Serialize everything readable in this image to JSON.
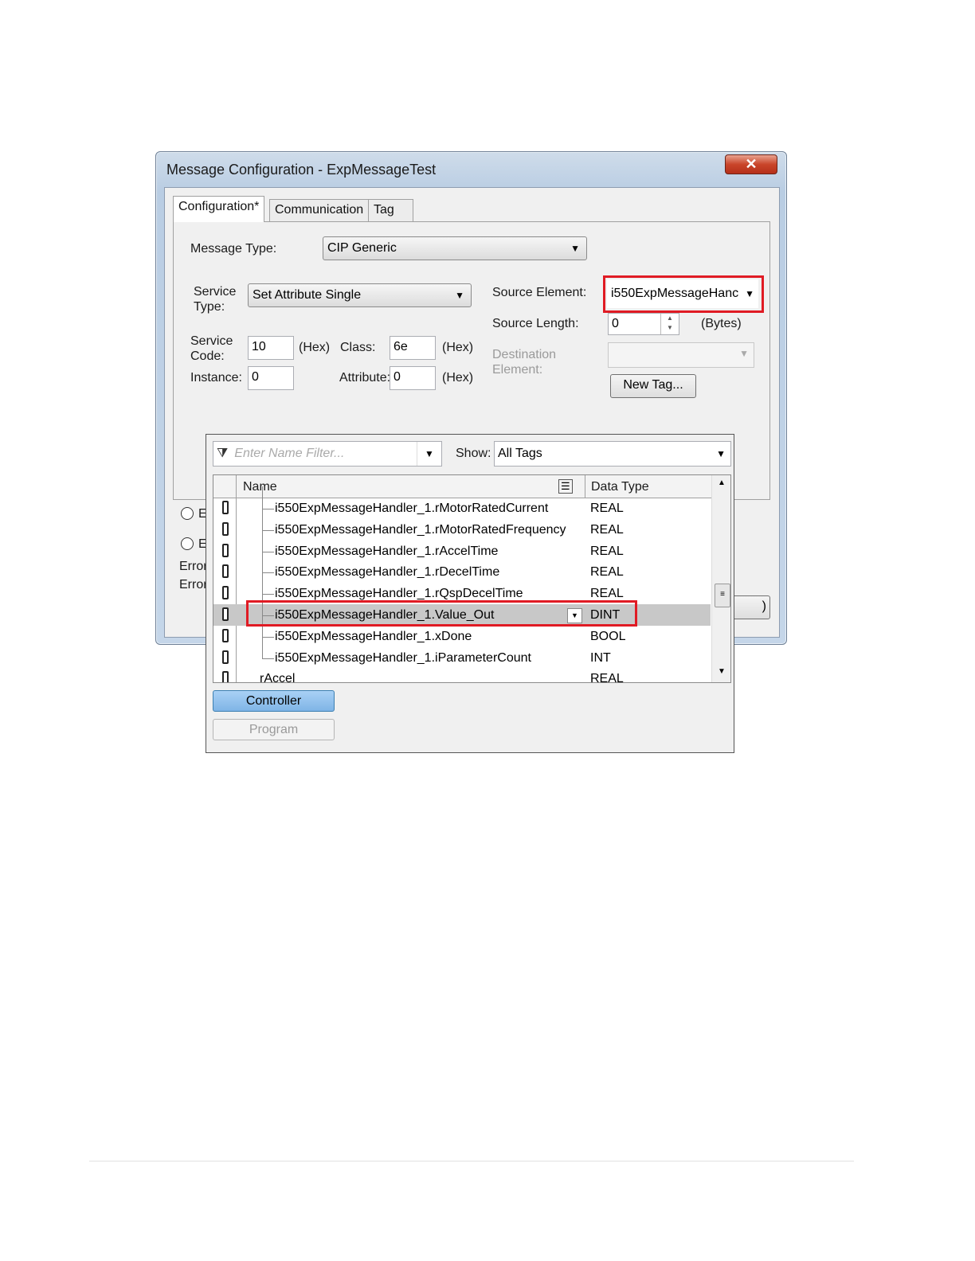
{
  "window": {
    "title": "Message Configuration - ExpMessageTest",
    "close_glyph": "✕"
  },
  "tabs": [
    {
      "label": "Configuration*"
    },
    {
      "label": "Communication"
    },
    {
      "label": "Tag"
    }
  ],
  "config": {
    "message_type_label": "Message Type:",
    "message_type_value": "CIP Generic",
    "service_type_label_1": "Service",
    "service_type_label_2": "Type:",
    "service_type_value": "Set Attribute Single",
    "service_code_label_1": "Service",
    "service_code_label_2": "Code:",
    "service_code_value": "10",
    "hex1": "(Hex)",
    "class_label": "Class:",
    "class_value": "6e",
    "hex2": "(Hex)",
    "instance_label": "Instance:",
    "instance_value": "0",
    "attribute_label": "Attribute:",
    "attribute_value": "0",
    "hex3": "(Hex)",
    "source_element_label": "Source Element:",
    "source_element_value": "i550ExpMessageHanc",
    "source_length_label": "Source Length:",
    "source_length_value": "0",
    "bytes_label": "(Bytes)",
    "destination_label_1": "Destination",
    "destination_label_2": "Element:",
    "new_tag_button": "New Tag..."
  },
  "lower": {
    "radio1_partial": "E",
    "radio2_partial": "E",
    "error1_partial": "Error",
    "error2_partial": "Error",
    "button_partial": ")"
  },
  "tag_browser": {
    "filter_placeholder": "Enter Name Filter...",
    "show_label": "Show:",
    "show_value": "All Tags",
    "col_name": "Name",
    "col_type": "Data Type",
    "rows": [
      {
        "name": "i550ExpMessageHandler_1.rMotorRatedCurrent",
        "type": "REAL"
      },
      {
        "name": "i550ExpMessageHandler_1.rMotorRatedFrequency",
        "type": "REAL"
      },
      {
        "name": "i550ExpMessageHandler_1.rAccelTime",
        "type": "REAL"
      },
      {
        "name": "i550ExpMessageHandler_1.rDecelTime",
        "type": "REAL"
      },
      {
        "name": "i550ExpMessageHandler_1.rQspDecelTime",
        "type": "REAL"
      },
      {
        "name": "i550ExpMessageHandler_1.Value_Out",
        "type": "DINT"
      },
      {
        "name": "i550ExpMessageHandler_1.xDone",
        "type": "BOOL"
      },
      {
        "name": "i550ExpMessageHandler_1.iParameterCount",
        "type": "INT"
      },
      {
        "name": "rAccel",
        "type": "REAL"
      }
    ],
    "controller_button": "Controller",
    "program_button": "Program"
  },
  "colors": {
    "highlight_red": "#e01b24",
    "selected_row": "#c8c8c8",
    "controller_blue": "#7fb4e6"
  }
}
